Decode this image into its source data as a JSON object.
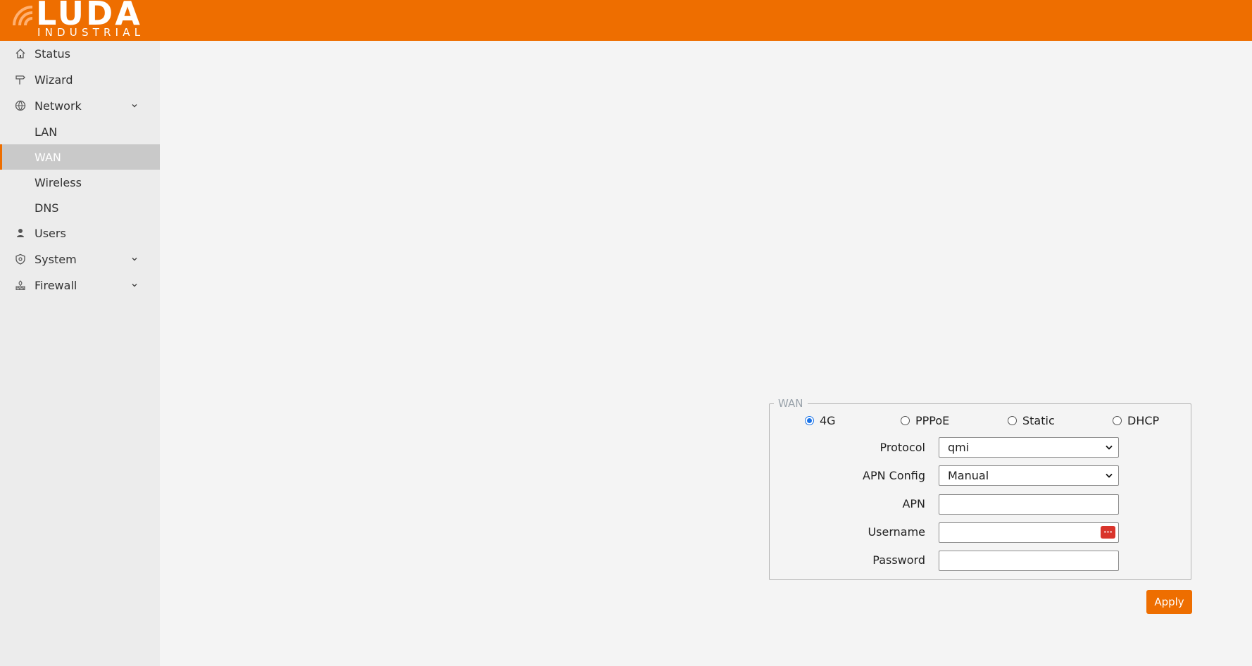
{
  "brand": {
    "name": "LUDA",
    "subtitle": "INDUSTRIAL",
    "accent_color": "#ee6e00"
  },
  "sidebar": {
    "items": [
      {
        "label": "Status",
        "icon": "home-icon"
      },
      {
        "label": "Wizard",
        "icon": "signpost-icon"
      },
      {
        "label": "Network",
        "icon": "globe-icon",
        "expandable": true,
        "expanded": true
      },
      {
        "label": "LAN",
        "sub": true
      },
      {
        "label": "WAN",
        "sub": true,
        "active": true
      },
      {
        "label": "Wireless",
        "sub": true
      },
      {
        "label": "DNS",
        "sub": true
      },
      {
        "label": "Users",
        "icon": "user-icon"
      },
      {
        "label": "System",
        "icon": "shield-icon",
        "expandable": true
      },
      {
        "label": "Firewall",
        "icon": "firewall-icon",
        "expandable": true
      }
    ]
  },
  "wan": {
    "legend": "WAN",
    "modes": [
      {
        "label": "4G",
        "checked": true
      },
      {
        "label": "PPPoE",
        "checked": false
      },
      {
        "label": "Static",
        "checked": false
      },
      {
        "label": "DHCP",
        "checked": false
      }
    ],
    "protocol": {
      "label": "Protocol",
      "value": "qmi"
    },
    "apn_config": {
      "label": "APN Config",
      "value": "Manual"
    },
    "apn": {
      "label": "APN",
      "value": ""
    },
    "username": {
      "label": "Username",
      "value": "",
      "badge": "···"
    },
    "password": {
      "label": "Password",
      "value": ""
    },
    "apply_label": "Apply"
  }
}
